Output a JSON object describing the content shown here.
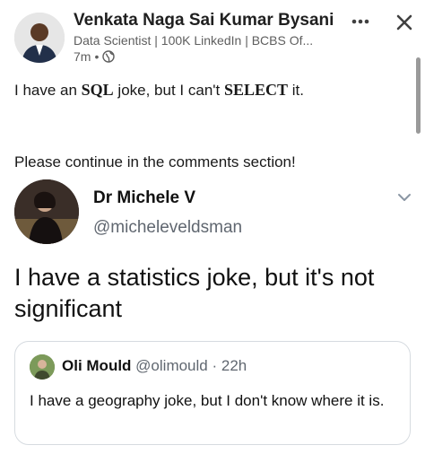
{
  "post": {
    "author_name": "Venkata Naga Sai Kumar Bysani",
    "author_headline": "Data Scientist | 100K LinkedIn | BCBS Of...",
    "time": "7m",
    "separator": "•",
    "text_line1_a": "I have an ",
    "text_line1_sql": "SQL",
    "text_line1_b": " joke, but I can't ",
    "text_line1_select": "SELECT",
    "text_line1_c": " it.",
    "text_line2": "Please continue in the comments section!",
    "icons": [
      "more-icon",
      "close-icon",
      "globe-icon"
    ]
  },
  "tweet": {
    "name": "Dr Michele V",
    "handle": "@micheleveldsman",
    "text": "I have a statistics joke, but it's not significant",
    "icons": [
      "chevron-down-icon"
    ]
  },
  "quote": {
    "name": "Oli Mould",
    "handle": "@olimould",
    "dot": "·",
    "time": "22h",
    "text": "I have a geography joke, but I don't know where it is."
  },
  "colors": {
    "text": "#191919",
    "secondary": "#5e5e5e",
    "twitter_gray": "#606770",
    "border": "#d6dbe0"
  }
}
